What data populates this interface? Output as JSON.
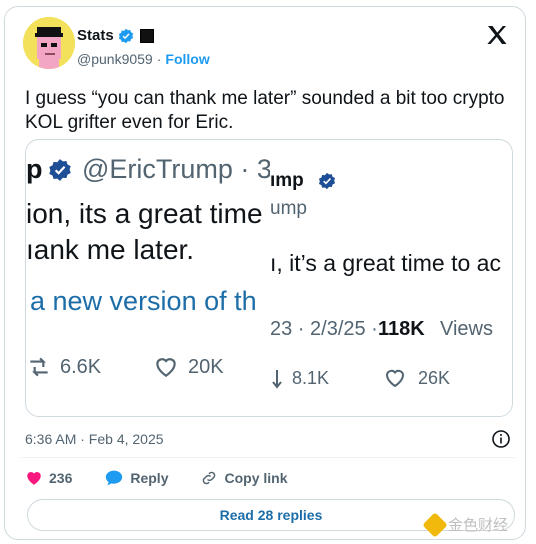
{
  "author": {
    "display_name": "Stats",
    "handle": "@punk9059",
    "separator": "·",
    "follow_label": "Follow"
  },
  "tweet": {
    "text": "I guess “you can thank me later” sounded a bit too crypto KOL grifter even for Eric.",
    "timestamp": "6:36 AM · Feb 4, 2025"
  },
  "quoted_screens": {
    "back": {
      "name_fragment": "p",
      "handle_time": "@EricTrump · 3",
      "line1": "ion, its a great time",
      "line2": "ıank me later.",
      "line3": "a new version of th",
      "retweets": "6.6K",
      "likes": "20K"
    },
    "front": {
      "name_fragment": "ımp",
      "handle_fragment": "ump",
      "line1": "ı, it’s a great time to ac",
      "date_fragment": "23 · 2/3/25 ·",
      "views_count": "118K",
      "views_label": "Views",
      "retweets": "8.1K",
      "likes": "26K"
    }
  },
  "actions": {
    "likes": "236",
    "reply_label": "Reply",
    "copy_link_label": "Copy link"
  },
  "read_replies_label": "Read 28 replies",
  "watermark": "金色财经",
  "colors": {
    "accent_blue": "#1d9bf0",
    "like_pink": "#f91880",
    "text_dark": "#0f1419",
    "text_gray": "#536471"
  }
}
